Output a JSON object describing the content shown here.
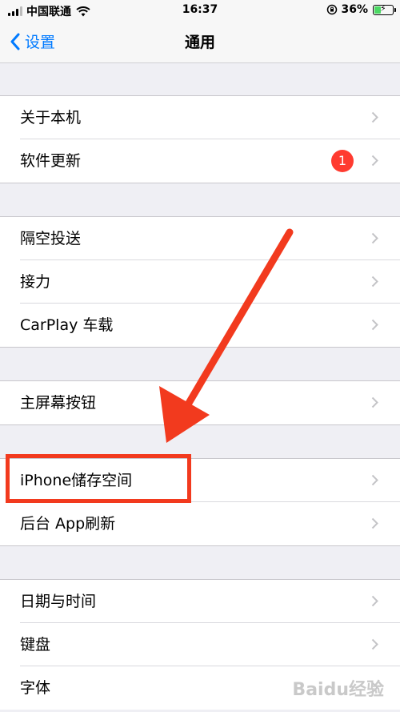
{
  "status_bar": {
    "carrier": "中国联通",
    "time": "16:37",
    "battery_percent": "36%",
    "battery_level": 0.36
  },
  "nav": {
    "back_label": "设置",
    "title": "通用"
  },
  "groups": [
    {
      "rows": [
        {
          "label": "关于本机"
        },
        {
          "label": "软件更新",
          "badge": "1"
        }
      ]
    },
    {
      "rows": [
        {
          "label": "隔空投送"
        },
        {
          "label": "接力"
        },
        {
          "label": "CarPlay 车载"
        }
      ]
    },
    {
      "rows": [
        {
          "label": "主屏幕按钮"
        }
      ]
    },
    {
      "rows": [
        {
          "label": "iPhone储存空间"
        },
        {
          "label": "后台 App刷新"
        }
      ]
    },
    {
      "rows": [
        {
          "label": "日期与时间"
        },
        {
          "label": "键盘"
        },
        {
          "label": "字体"
        }
      ]
    }
  ],
  "annotation": {
    "color": "#f23a1e"
  },
  "watermark": "Baidu经验",
  "icons": [
    "signal-icon",
    "wifi-icon",
    "orientation-lock-icon",
    "battery-icon",
    "back-chevron-icon",
    "chevron-right-icon"
  ]
}
